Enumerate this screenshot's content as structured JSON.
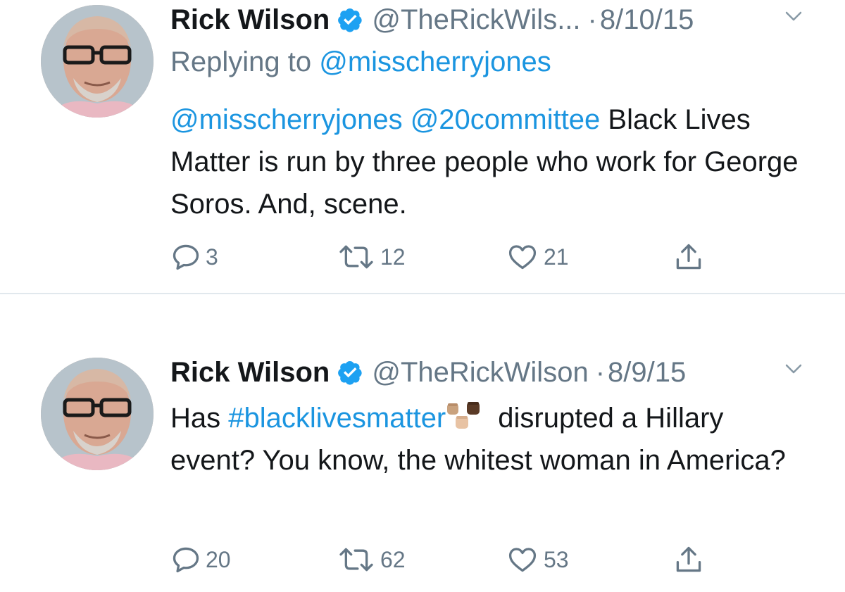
{
  "tweets": [
    {
      "name": "Rick Wilson",
      "handle": "@TheRickWils...",
      "separator": "·",
      "date": "8/10/15",
      "replying_prefix": "Replying to ",
      "replying_to": "@misscherryjones",
      "text": {
        "mention1": "@misscherryjones",
        "mention2": "@20committee",
        "body": " Black Lives Matter is run by three people who work for George Soros. And, scene."
      },
      "counts": {
        "replies": "3",
        "retweets": "12",
        "likes": "21"
      }
    },
    {
      "name": "Rick Wilson",
      "handle": "@TheRickWilson",
      "separator": "·",
      "date": "8/9/15",
      "text": {
        "prefix": "Has ",
        "hashtag": "#blacklivesmatter",
        "body": "disrupted a Hillary event? You know, the whitest woman in America?"
      },
      "counts": {
        "replies": "20",
        "retweets": "62",
        "likes": "53"
      }
    }
  ],
  "colors": {
    "link": "#1b95e0",
    "secondary": "#657786",
    "text": "#14171a",
    "divider": "#e1e8ed",
    "verified": "#1da1f2"
  },
  "icons": {
    "verified": "verified-badge-icon",
    "caret": "chevron-down-icon",
    "reply": "reply-icon",
    "retweet": "retweet-icon",
    "like": "heart-icon",
    "share": "share-icon",
    "emoji": "raised-fists-emoji-icon"
  }
}
